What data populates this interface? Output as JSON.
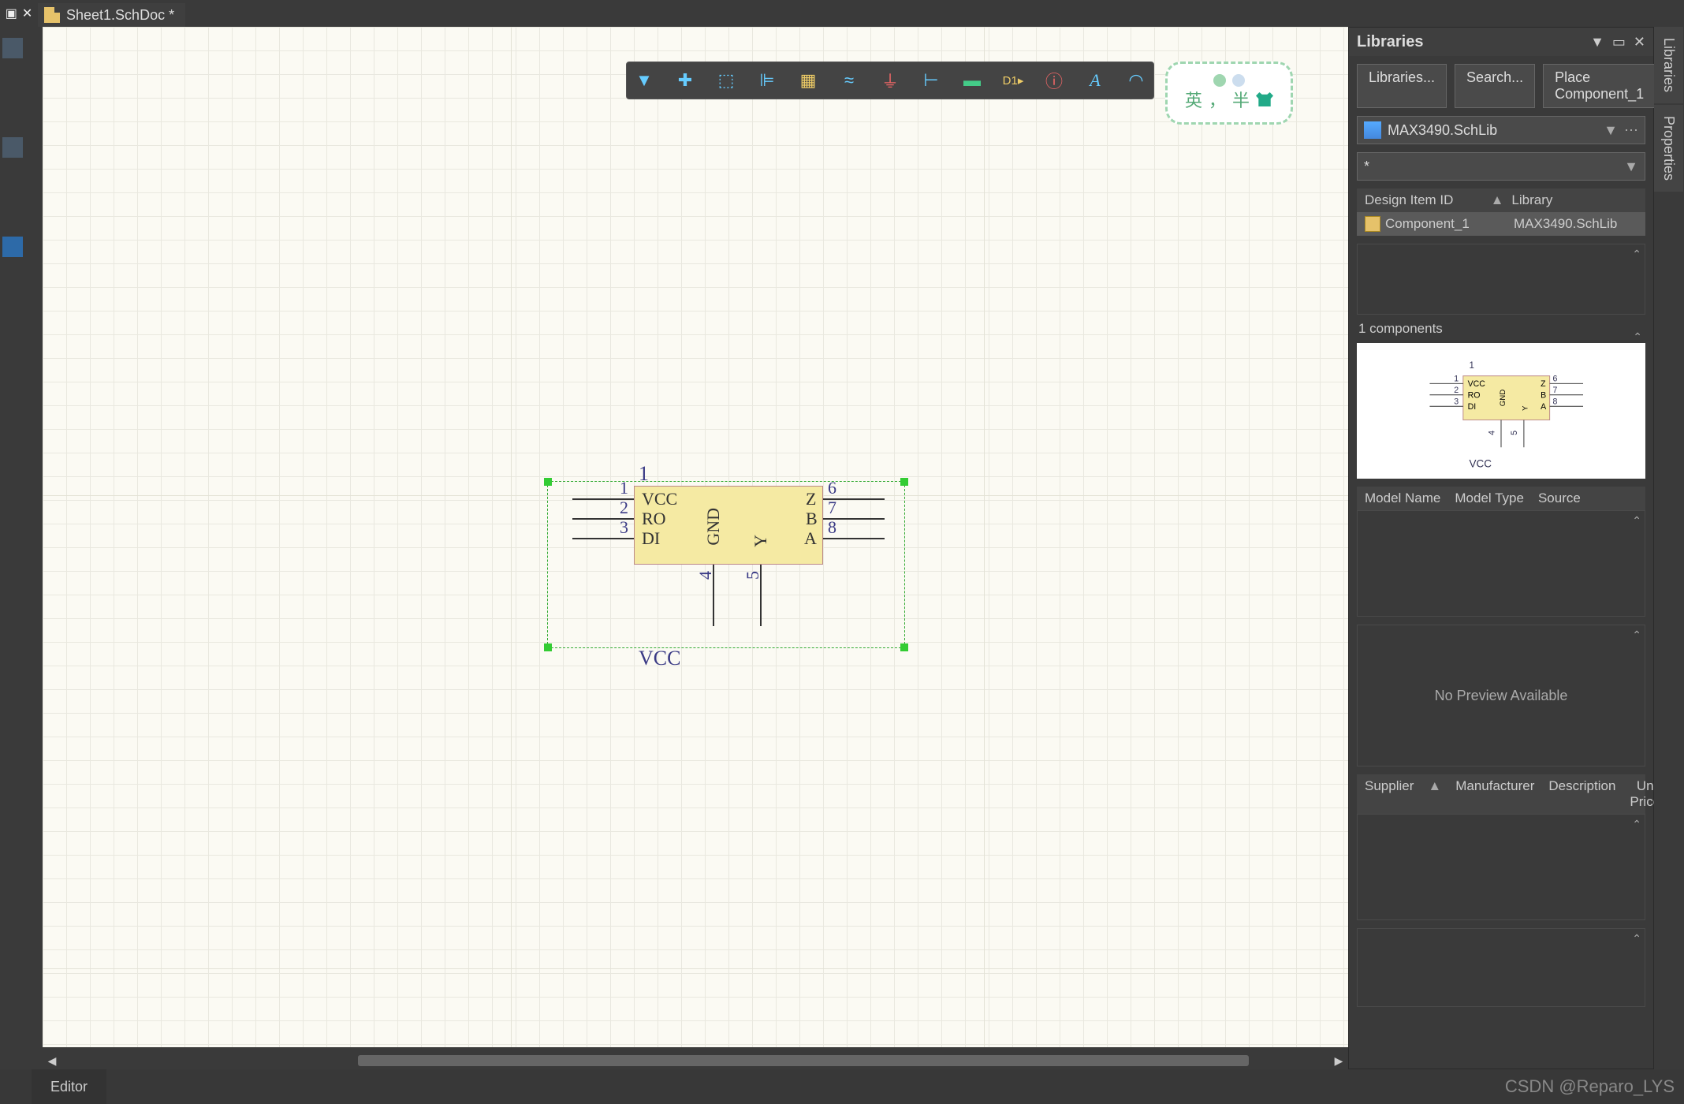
{
  "tab": {
    "close_prev": "✕",
    "pin": "📌",
    "doc_label": "Sheet1.SchDoc *"
  },
  "toolbar": {
    "icons": [
      "filter",
      "move",
      "select",
      "align",
      "chip",
      "net",
      "gnd",
      "pin",
      "bus",
      "part",
      "info",
      "text",
      "arc"
    ]
  },
  "badge": {
    "t1": "英",
    "t2": "，",
    "t3": "半"
  },
  "component": {
    "designator": "1",
    "ref_label": "VCC",
    "left_pins": [
      {
        "num": "1",
        "name": "VCC"
      },
      {
        "num": "2",
        "name": "RO"
      },
      {
        "num": "3",
        "name": "DI"
      }
    ],
    "right_pins": [
      {
        "num": "6",
        "name": "Z"
      },
      {
        "num": "7",
        "name": "B"
      },
      {
        "num": "8",
        "name": "A"
      }
    ],
    "bottom_pins": [
      {
        "num": "4",
        "name": "GND"
      },
      {
        "num": "5",
        "name": "Y"
      }
    ]
  },
  "libraries": {
    "title": "Libraries",
    "btn_lib": "Libraries...",
    "btn_search": "Search...",
    "btn_place": "Place Component_1",
    "current_lib": "MAX3490.SchLib",
    "filter": "*",
    "col_design": "Design Item ID",
    "col_lib": "Library",
    "row_item": "Component_1",
    "row_lib": "MAX3490.SchLib",
    "count": "1 components",
    "model_cols": {
      "name": "Model Name",
      "type": "Model Type",
      "source": "Source"
    },
    "no_preview": "No Preview Available",
    "supplier_cols": {
      "sup": "Supplier",
      "mfr": "Manufacturer",
      "desc": "Description",
      "price": "Unit Price"
    },
    "preview_ref": "VCC"
  },
  "right_tabs": {
    "lib": "Libraries",
    "props": "Properties"
  },
  "footer": {
    "editor": "Editor",
    "watermark": "CSDN @Reparo_LYS"
  }
}
